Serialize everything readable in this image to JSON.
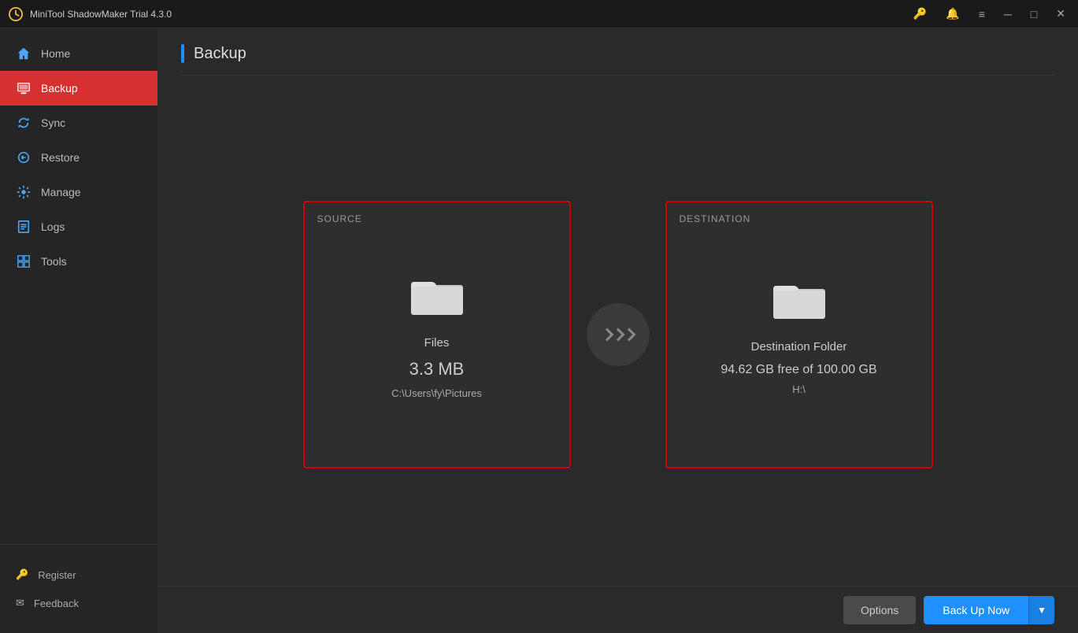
{
  "titlebar": {
    "logo_label": "MiniTool",
    "title": "MiniTool ShadowMaker Trial 4.3.0"
  },
  "sidebar": {
    "items": [
      {
        "id": "home",
        "label": "Home",
        "active": false
      },
      {
        "id": "backup",
        "label": "Backup",
        "active": true
      },
      {
        "id": "sync",
        "label": "Sync",
        "active": false
      },
      {
        "id": "restore",
        "label": "Restore",
        "active": false
      },
      {
        "id": "manage",
        "label": "Manage",
        "active": false
      },
      {
        "id": "logs",
        "label": "Logs",
        "active": false
      },
      {
        "id": "tools",
        "label": "Tools",
        "active": false
      }
    ],
    "bottom_items": [
      {
        "id": "register",
        "label": "Register"
      },
      {
        "id": "feedback",
        "label": "Feedback"
      }
    ]
  },
  "page": {
    "title": "Backup"
  },
  "source_card": {
    "label": "SOURCE",
    "name": "Files",
    "size": "3.3 MB",
    "path": "C:\\Users\\fy\\Pictures"
  },
  "destination_card": {
    "label": "DESTINATION",
    "name": "Destination Folder",
    "free_text": "94.62 GB free of 100.00 GB",
    "path": "H:\\"
  },
  "buttons": {
    "options_label": "Options",
    "backup_now_label": "Back Up Now",
    "dropdown_arrow": "▼"
  }
}
